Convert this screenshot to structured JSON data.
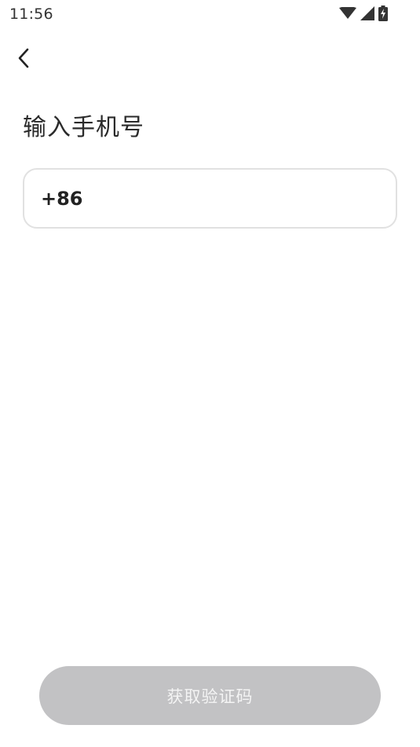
{
  "status_bar": {
    "time": "11:56",
    "icons": [
      "wifi-icon",
      "cellular-signal-icon",
      "battery-charging-icon"
    ]
  },
  "header": {
    "back_icon": "chevron-left-icon"
  },
  "main": {
    "title": "输入手机号",
    "phone_field": {
      "country_code": "+86",
      "value": "",
      "placeholder": ""
    },
    "get_code_button": {
      "label": "获取验证码",
      "enabled": false
    }
  },
  "colors": {
    "button_disabled_bg": "#c2c2c4",
    "button_disabled_text": "#f4f4f4",
    "field_border": "#e1e1e1",
    "title_text": "#2a2a2a"
  }
}
